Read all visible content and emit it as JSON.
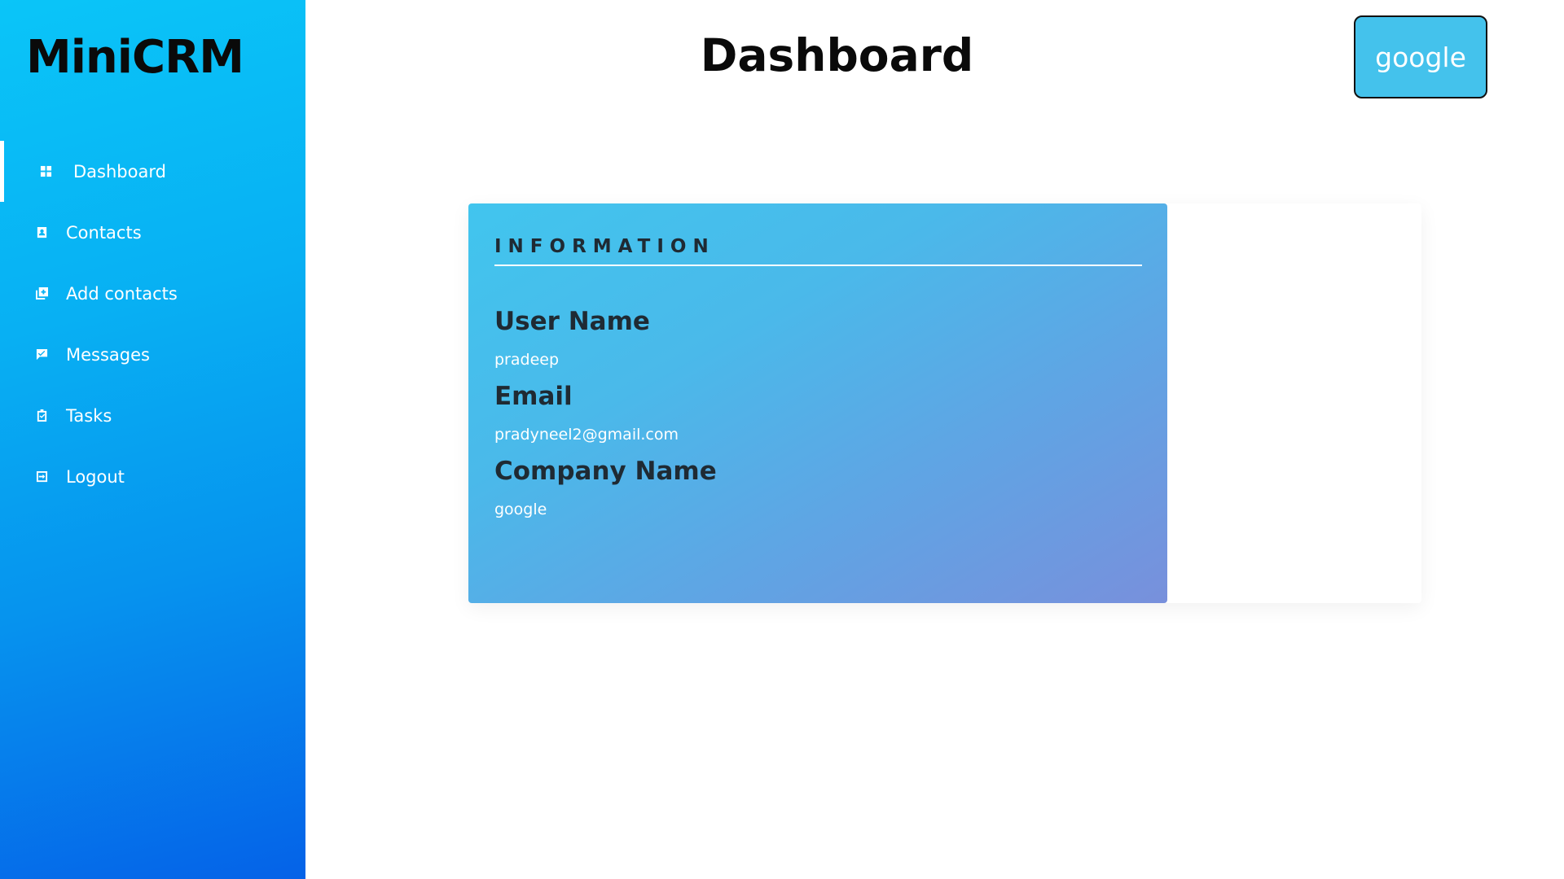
{
  "app": {
    "logo": "MiniCRM"
  },
  "sidebar": {
    "items": [
      {
        "label": "Dashboard",
        "icon": "dashboard-icon",
        "active": true
      },
      {
        "label": "Contacts",
        "icon": "contact-card-icon",
        "active": false
      },
      {
        "label": "Add contacts",
        "icon": "add-contact-icon",
        "active": false
      },
      {
        "label": "Messages",
        "icon": "message-icon",
        "active": false
      },
      {
        "label": "Tasks",
        "icon": "clipboard-check-icon",
        "active": false
      },
      {
        "label": "Logout",
        "icon": "logout-icon",
        "active": false
      }
    ]
  },
  "header": {
    "title": "Dashboard",
    "company_button": "google"
  },
  "card": {
    "heading": "INFORMATION",
    "fields": [
      {
        "label": "User Name",
        "value": "pradeep"
      },
      {
        "label": "Email",
        "value": "pradyneel2@gmail.com"
      },
      {
        "label": "Company Name",
        "value": "google"
      }
    ]
  },
  "colors": {
    "sidebar_gradient_start": "#0ac5f8",
    "sidebar_gradient_end": "#0562e8",
    "button_bg": "#44c2ec",
    "card_gradient_start": "#41c5ee",
    "card_gradient_end": "#7890dc",
    "heading_text": "#1f2a33"
  }
}
